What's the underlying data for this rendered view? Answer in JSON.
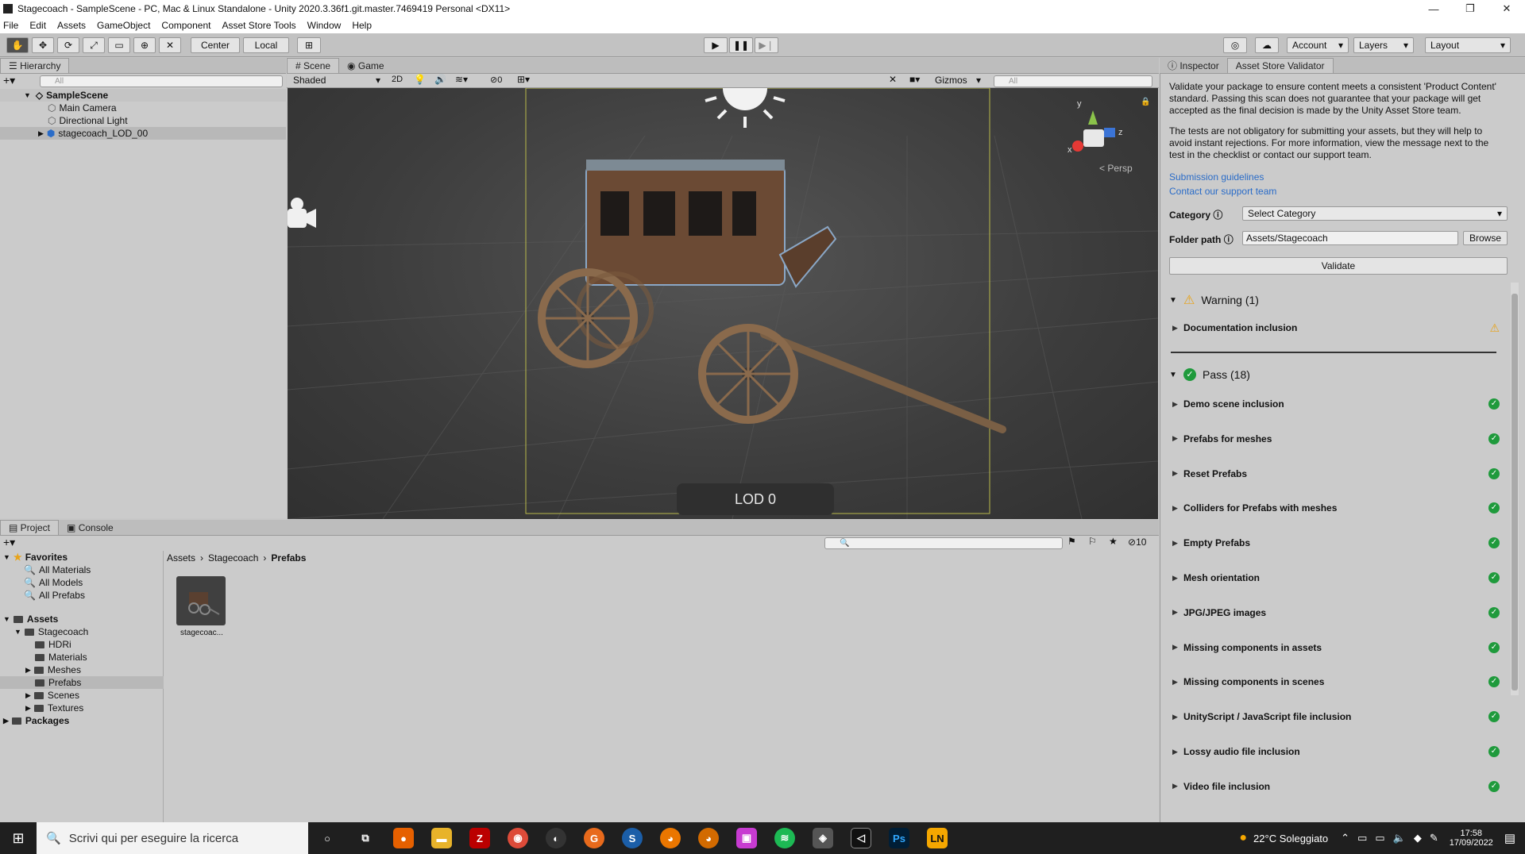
{
  "window": {
    "title": "Stagecoach - SampleScene - PC, Mac & Linux Standalone - Unity 2020.3.36f1.git.master.7469419 Personal <DX11>",
    "minimize": "—",
    "maximize": "❐",
    "close": "✕"
  },
  "menu": [
    "File",
    "Edit",
    "Assets",
    "GameObject",
    "Component",
    "Asset Store Tools",
    "Window",
    "Help"
  ],
  "toolbar": {
    "center": "Center",
    "local": "Local",
    "account": "Account",
    "layers": "Layers",
    "layout": "Layout"
  },
  "hierarchy": {
    "tab": "Hierarchy",
    "search_placeholder": "All",
    "scene": "SampleScene",
    "items": [
      "Main Camera",
      "Directional Light",
      "stagecoach_LOD_00"
    ]
  },
  "scene_tabs": {
    "scene": "Scene",
    "game": "Game"
  },
  "scene_toolbar": {
    "shading": "Shaded",
    "mode2d": "2D",
    "hidden_count": "0",
    "gizmos": "Gizmos",
    "search_placeholder": "All"
  },
  "scene_view": {
    "persp": "Persp",
    "lod": "LOD 0",
    "axis_x": "x",
    "axis_y": "y",
    "axis_z": "z"
  },
  "right_tabs": {
    "inspector": "Inspector",
    "validator": "Asset Store Validator"
  },
  "validator": {
    "intro1": "Validate your package to ensure content meets a consistent 'Product Content' standard. Passing this scan does not guarantee that your package will get accepted as the final decision is made by the Unity Asset Store team.",
    "intro2": "The tests are not obligatory for submitting your assets, but they will help to avoid instant rejections. For more information, view the message next to the test in the checklist or contact our support team.",
    "link1": "Submission guidelines",
    "link2": "Contact our support team",
    "category_label": "Category",
    "category_value": "Select Category",
    "folder_label": "Folder path",
    "folder_value": "Assets/Stagecoach",
    "browse": "Browse",
    "validate": "Validate",
    "warning_header": "Warning (1)",
    "warning_items": [
      "Documentation inclusion"
    ],
    "pass_header": "Pass (18)",
    "pass_items": [
      "Demo scene inclusion",
      "Prefabs for meshes",
      "Reset Prefabs",
      "Colliders for Prefabs with meshes",
      "Empty Prefabs",
      "Mesh orientation",
      "JPG/JPEG images",
      "Missing components in assets",
      "Missing components in scenes",
      "UnityScript / JavaScript file inclusion",
      "Lossy audio file inclusion",
      "Video file inclusion"
    ]
  },
  "project": {
    "tab": "Project",
    "console_tab": "Console",
    "hidden_count": "10",
    "favorites": "Favorites",
    "fav_items": [
      "All Materials",
      "All Models",
      "All Prefabs"
    ],
    "assets": "Assets",
    "stagecoach": "Stagecoach",
    "sub": [
      "HDRi",
      "Materials",
      "Meshes",
      "Prefabs",
      "Scenes",
      "Textures"
    ],
    "packages": "Packages",
    "breadcrumb": [
      "Assets",
      "Stagecoach",
      "Prefabs"
    ],
    "asset_name": "stagecoac..."
  },
  "taskbar": {
    "search": "Scrivi qui per eseguire la ricerca",
    "weather": "22°C Soleggiato",
    "time": "17:58",
    "date": "17/09/2022",
    "ln": "LN",
    "ps": "Ps"
  },
  "colors": {
    "accent_link": "#2a6cc8",
    "pass": "#1f9a3c",
    "warning": "#e8a317",
    "selection": "#b8b8b8"
  }
}
